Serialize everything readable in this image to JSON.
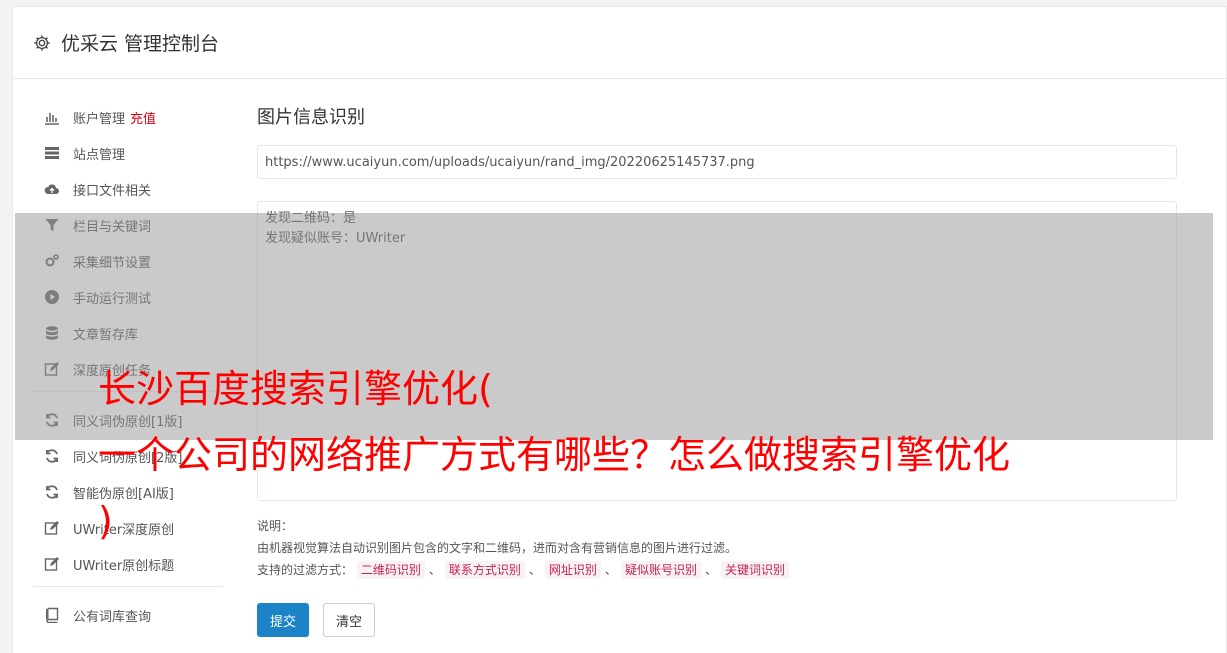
{
  "header": {
    "title": "优采云 管理控制台",
    "icon": "gear-icon"
  },
  "sidebar": {
    "items": [
      {
        "label": "账户管理",
        "badge": "充值",
        "icon": "bar-chart-icon"
      },
      {
        "label": "站点管理",
        "icon": "server-icon"
      },
      {
        "label": "接口文件相关",
        "icon": "cloud-upload-icon"
      },
      {
        "label": "栏目与关键词",
        "icon": "filter-icon"
      },
      {
        "label": "采集细节设置",
        "icon": "cogs-icon"
      },
      {
        "label": "手动运行测试",
        "icon": "play-circle-icon"
      },
      {
        "label": "文章暂存库",
        "icon": "database-icon"
      },
      {
        "label": "深度原创任务",
        "icon": "edit-icon"
      },
      {
        "label": "同义词伪原创[1版]",
        "icon": "refresh-icon"
      },
      {
        "label": "同义词伪原创[2版]",
        "icon": "refresh-icon"
      },
      {
        "label": "智能伪原创[AI版]",
        "icon": "refresh-icon"
      },
      {
        "label": "UWriter深度原创",
        "icon": "edit-icon"
      },
      {
        "label": "UWriter原创标题",
        "icon": "edit-icon"
      },
      {
        "label": "公有词库查询",
        "icon": "book-icon"
      }
    ]
  },
  "main": {
    "title": "图片信息识别",
    "url_value": "https://www.ucaiyun.com/uploads/ucaiyun/rand_img/20220625145737.png",
    "result_lines": [
      "发现二维码：是",
      "发现疑似账号：UWriter"
    ],
    "desc_label": "说明：",
    "desc_text": "由机器视觉算法自动识别图片包含的文字和二维码，进而对含有营销信息的图片进行过滤。",
    "filter_label": "支持的过滤方式：",
    "filter_tags": [
      "二维码识别",
      "联系方式识别",
      "网址识别",
      "疑似账号识别",
      "关键词识别"
    ],
    "filter_sep": "、",
    "submit_label": "提交",
    "clear_label": "清空"
  },
  "overlay": {
    "line1": "长沙百度搜索引擎优化(",
    "line2": "一个公司的网络推广方式有哪些？怎么做搜索引擎优化",
    "line3": ")"
  },
  "colors": {
    "primary": "#1c84c6",
    "badge": "#d9001b",
    "tag_text": "#c7254e",
    "tag_bg": "#f9f2f4",
    "overlay_text": "#ff0000"
  }
}
